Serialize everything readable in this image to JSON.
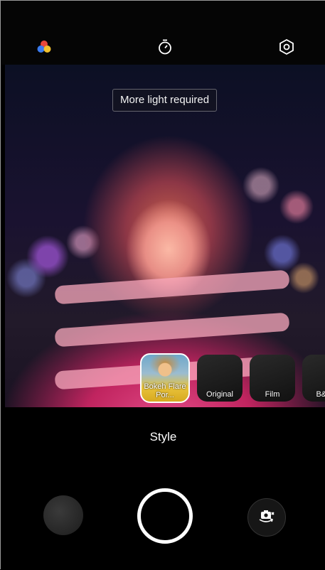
{
  "camera": {
    "top_bar": {
      "icons": [
        "filter-color-icon",
        "timer-icon",
        "settings-icon"
      ]
    },
    "toast": {
      "text": "More light required"
    },
    "styles": [
      {
        "label": "Bokeh Flare Por...",
        "selected": true
      },
      {
        "label": "Original",
        "selected": false
      },
      {
        "label": "Film",
        "selected": false
      },
      {
        "label": "B&W",
        "selected": false
      }
    ],
    "mode_label": "Style",
    "bottom_controls": {
      "icons": [
        "gallery-thumbnail",
        "shutter-button",
        "switch-camera-icon"
      ]
    },
    "colors": {
      "accent_red": "#e8473a",
      "accent_blue": "#3a7bf0",
      "accent_yellow": "#f2c12e"
    }
  }
}
